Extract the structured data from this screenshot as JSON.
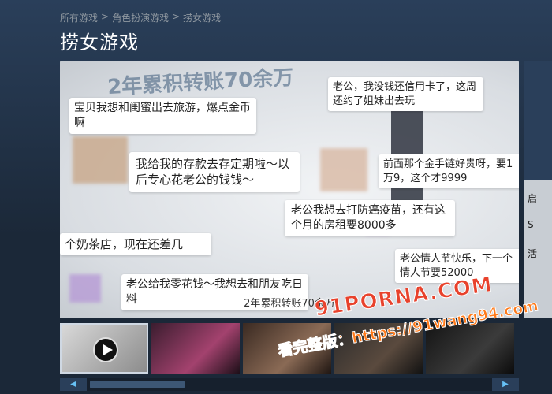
{
  "breadcrumb": {
    "items": [
      "所有游戏",
      "角色扮演游戏",
      "捞女游戏"
    ],
    "sep": ">"
  },
  "page_title": "捞女游戏",
  "media": {
    "headline": "2年累积转账70余万",
    "bubbles": [
      "宝贝我想和闺蜜出去旅游，爆点金币嘛",
      "老公，我没钱还信用卡了，这周还约了姐妹出去玩",
      "我给我的存款去存定期啦～以后专心花老公的钱钱～",
      "前面那个金手链好贵呀，要1万9，这个才9999",
      "个奶茶店，现在还差几",
      "老公我想去打防癌疫苗，还有这个月的房租要8000多",
      "老公给我零花钱～我想去和朋友吃日料",
      "老公情人节快乐，下一个情人节要52000"
    ],
    "caption": "2年累积转账70余万"
  },
  "side_panel": {
    "text_lines": [
      "启",
      "S",
      "活"
    ]
  },
  "watermark": {
    "line1": "91PORNA.COM",
    "line2": "看完整版：https://91wang94.com"
  },
  "thumbnails": [
    {
      "name": "video-thumbnail",
      "is_video": true
    },
    {
      "name": "screenshot-2",
      "is_video": false
    },
    {
      "name": "screenshot-3",
      "is_video": false
    },
    {
      "name": "screenshot-4",
      "is_video": false
    },
    {
      "name": "screenshot-5",
      "is_video": false
    }
  ],
  "scroll": {
    "left_icon": "◀",
    "right_icon": "▶"
  }
}
